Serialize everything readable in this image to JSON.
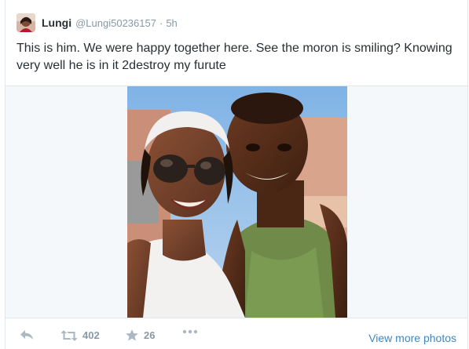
{
  "tweet": {
    "name": "Lungi",
    "handle": "@Lungi50236157",
    "separator": "·",
    "time": "5h",
    "text": "This is him. We were happy together here. See the moron is smiling? Knowing very well he is in it 2destroy my furute"
  },
  "actions": {
    "reply_icon": "reply-icon",
    "retweet_icon": "retweet-icon",
    "retweet_count": "402",
    "favorite_icon": "star-icon",
    "favorite_count": "26",
    "more_icon": "ellipsis-icon",
    "view_more_label": "View more photos"
  },
  "colors": {
    "text": "#292f33",
    "muted": "#8899a6",
    "link": "#3b88c3",
    "border": "#e1e8ed"
  }
}
